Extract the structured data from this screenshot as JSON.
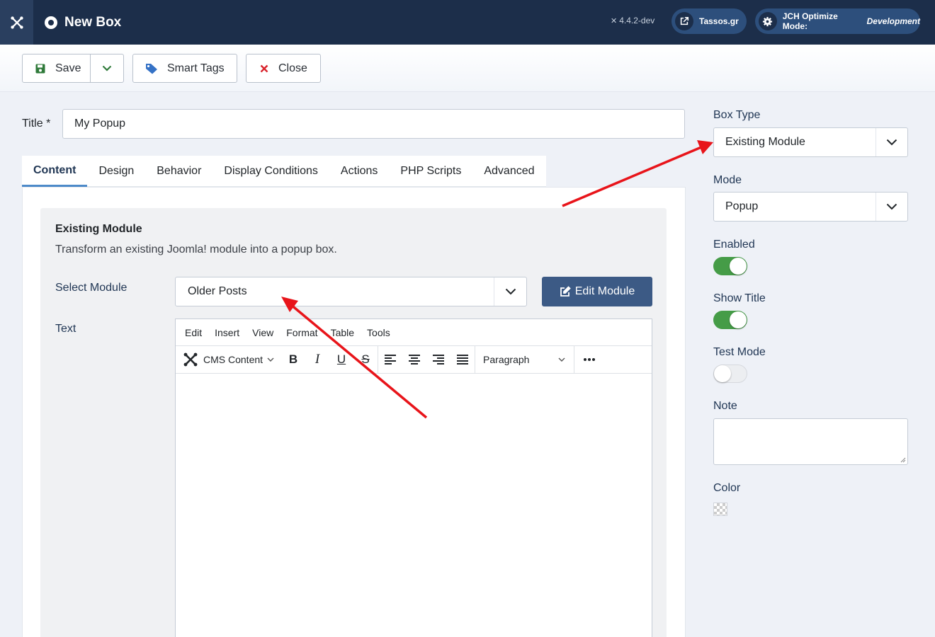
{
  "header": {
    "title": "New Box",
    "version": "4.4.2-dev",
    "tassos_label": "Tassos.gr",
    "jch_label": "JCH Optimize Mode:",
    "jch_mode": "Development"
  },
  "toolbar": {
    "save_label": "Save",
    "smart_tags_label": "Smart Tags",
    "close_label": "Close"
  },
  "form": {
    "title_label": "Title *",
    "title_value": "My Popup"
  },
  "tabs": [
    {
      "label": "Content"
    },
    {
      "label": "Design"
    },
    {
      "label": "Behavior"
    },
    {
      "label": "Display Conditions"
    },
    {
      "label": "Actions"
    },
    {
      "label": "PHP Scripts"
    },
    {
      "label": "Advanced"
    }
  ],
  "content": {
    "section_title": "Existing Module",
    "section_desc": "Transform an existing Joomla! module into a popup box.",
    "select_module_label": "Select Module",
    "select_module_value": "Older Posts",
    "edit_module_label": "Edit Module",
    "text_label": "Text"
  },
  "editor": {
    "menus": [
      "Edit",
      "Insert",
      "View",
      "Format",
      "Table",
      "Tools"
    ],
    "cms_content_label": "CMS Content",
    "block_format": "Paragraph"
  },
  "sidebar": {
    "box_type_label": "Box Type",
    "box_type_value": "Existing Module",
    "mode_label": "Mode",
    "mode_value": "Popup",
    "enabled_label": "Enabled",
    "enabled_state": true,
    "show_title_label": "Show Title",
    "show_title_state": true,
    "test_mode_label": "Test Mode",
    "test_mode_state": false,
    "note_label": "Note",
    "color_label": "Color"
  },
  "colors": {
    "header_bg": "#1c2e4a",
    "primary_button": "#3c5a85",
    "toggle_on": "#459c47",
    "annotation_arrow": "#e8141a",
    "close_icon": "#d9232c",
    "save_icon": "#2f7a3a",
    "tag_icon": "#3572c6"
  }
}
